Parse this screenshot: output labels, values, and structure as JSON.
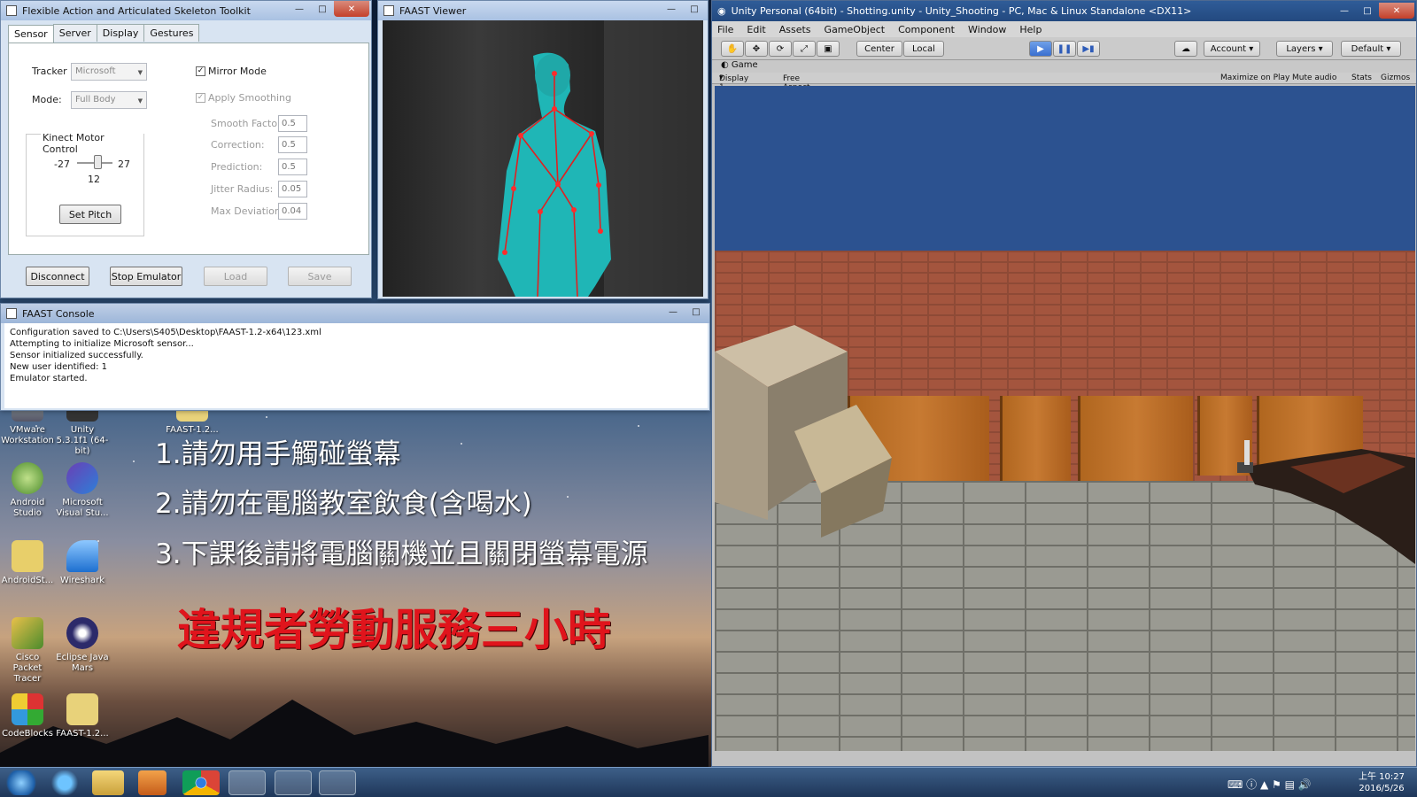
{
  "faast_main": {
    "title": "Flexible Action and Articulated Skeleton Toolkit",
    "tabs": [
      "Sensor",
      "Server",
      "Display",
      "Gestures"
    ],
    "tracker_label": "Tracker",
    "tracker_value": "Microsoft",
    "mode_label": "Mode:",
    "mode_value": "Full Body",
    "mirror_label": "Mirror Mode",
    "smoothing_label": "Apply Smoothing",
    "smooth_factor_label": "Smooth Factor:",
    "smooth_factor": "0.5",
    "correction_label": "Correction:",
    "correction": "0.5",
    "prediction_label": "Prediction:",
    "prediction": "0.5",
    "jitter_label": "Jitter Radius:",
    "jitter": "0.05",
    "maxdev_label": "Max Deviation:",
    "maxdev": "0.04",
    "motor_label": "Kinect Motor Control",
    "slider_min": "-27",
    "slider_max": "27",
    "slider_value": "12",
    "set_pitch": "Set Pitch",
    "btn_disconnect": "Disconnect",
    "btn_stop": "Stop Emulator",
    "btn_load": "Load",
    "btn_save": "Save"
  },
  "viewer": {
    "title": "FAAST Viewer"
  },
  "console": {
    "title": "FAAST Console",
    "lines": [
      "Configuration saved to C:\\Users\\S405\\Desktop\\FAAST-1.2-x64\\123.xml",
      "Attempting to initialize Microsoft sensor...",
      "Sensor initialized successfully.",
      "New user identified: 1",
      "Emulator started."
    ]
  },
  "desktop": {
    "icons": [
      {
        "label": "VMware Workstation"
      },
      {
        "label": "Unity 5.3.1f1 (64-bit)"
      },
      {
        "label": "FAAST-1.2..."
      },
      {
        "label": "Android Studio"
      },
      {
        "label": "Microsoft Visual Stu..."
      },
      {
        "label": "AndroidSt..."
      },
      {
        "label": "Wireshark"
      },
      {
        "label": "Cisco Packet Tracer"
      },
      {
        "label": "Eclipse Java Mars"
      },
      {
        "label": "CodeBlocks"
      },
      {
        "label": "FAAST-1.2..."
      }
    ],
    "rule1": "1.請勿用手觸碰螢幕",
    "rule2": "2.請勿在電腦教室飲食(含喝水)",
    "rule3": "3.下課後請將電腦關機並且關閉螢幕電源",
    "warning": "違規者勞動服務三小時"
  },
  "unity": {
    "title": "Unity Personal (64bit) - Shotting.unity - Unity_Shooting - PC, Mac & Linux Standalone <DX11>",
    "menu": [
      "File",
      "Edit",
      "Assets",
      "GameObject",
      "Component",
      "Window",
      "Help"
    ],
    "center": "Center",
    "local": "Local",
    "account": "Account",
    "layers": "Layers",
    "layout": "Default",
    "game_tab": "Game",
    "display": "Display 1",
    "aspect": "Free Aspect",
    "maximize": "Maximize on Play",
    "mute": "Mute audio",
    "stats": "Stats",
    "gizmos": "Gizmos"
  },
  "taskbar": {
    "time": "上午 10:27",
    "date": "2016/5/26"
  }
}
